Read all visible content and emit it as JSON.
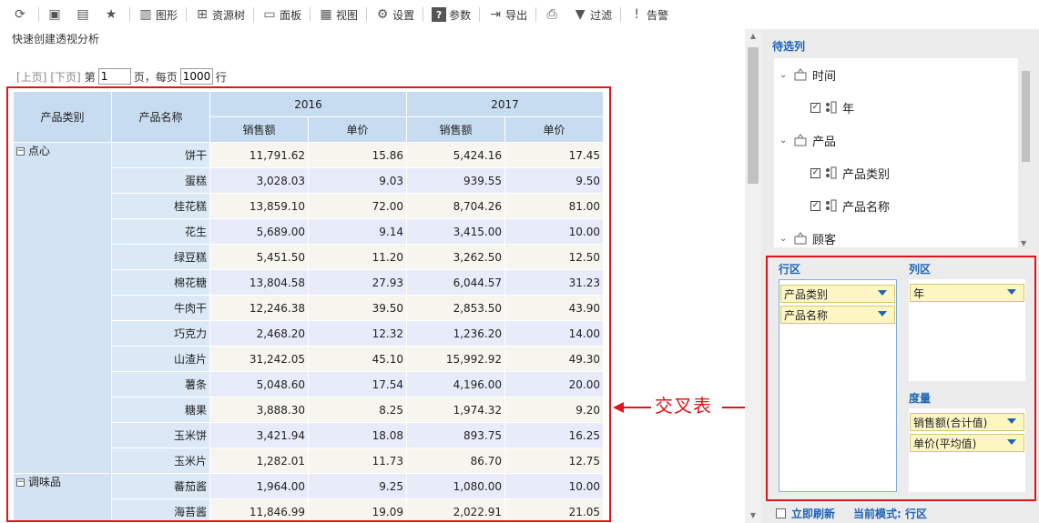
{
  "toolbar": {
    "items": [
      {
        "label": "",
        "icon": "refresh-icon"
      },
      {
        "label": "",
        "icon": "save-icon"
      },
      {
        "label": "",
        "icon": "save-as-icon"
      },
      {
        "label": "",
        "icon": "star-icon"
      },
      {
        "label": "图形",
        "icon": "chart-icon"
      },
      {
        "label": "资源树",
        "icon": "tree-icon"
      },
      {
        "label": "面板",
        "icon": "panel-icon"
      },
      {
        "label": "视图",
        "icon": "view-icon"
      },
      {
        "label": "设置",
        "icon": "gear-icon"
      },
      {
        "label": "参数",
        "icon": "question-icon"
      },
      {
        "label": "导出",
        "icon": "export-icon"
      },
      {
        "label": "",
        "icon": "print-icon"
      },
      {
        "label": "过滤",
        "icon": "filter-icon"
      },
      {
        "label": "告警",
        "icon": "alert-icon"
      }
    ]
  },
  "subtitle": "快速创建透视分析",
  "pager": {
    "prev": "[上页]",
    "next": "[下页]",
    "page_prefix": "第",
    "page_value": "1",
    "page_suffix": "页，每页",
    "rows_value": "1000",
    "rows_suffix": "行"
  },
  "table": {
    "row_headers": [
      "产品类别",
      "产品名称"
    ],
    "years": [
      "2016",
      "2017"
    ],
    "measures": [
      "销售额",
      "单价"
    ],
    "groups": [
      {
        "category": "点心",
        "rows": [
          {
            "name": "饼干",
            "v": [
              "11,791.62",
              "15.86",
              "5,424.16",
              "17.45"
            ]
          },
          {
            "name": "蛋糕",
            "v": [
              "3,028.03",
              "9.03",
              "939.55",
              "9.50"
            ]
          },
          {
            "name": "桂花糕",
            "v": [
              "13,859.10",
              "72.00",
              "8,704.26",
              "81.00"
            ]
          },
          {
            "name": "花生",
            "v": [
              "5,689.00",
              "9.14",
              "3,415.00",
              "10.00"
            ]
          },
          {
            "name": "绿豆糕",
            "v": [
              "5,451.50",
              "11.20",
              "3,262.50",
              "12.50"
            ]
          },
          {
            "name": "棉花糖",
            "v": [
              "13,804.58",
              "27.93",
              "6,044.57",
              "31.23"
            ]
          },
          {
            "name": "牛肉干",
            "v": [
              "12,246.38",
              "39.50",
              "2,853.50",
              "43.90"
            ]
          },
          {
            "name": "巧克力",
            "v": [
              "2,468.20",
              "12.32",
              "1,236.20",
              "14.00"
            ]
          },
          {
            "name": "山渣片",
            "v": [
              "31,242.05",
              "45.10",
              "15,992.92",
              "49.30"
            ]
          },
          {
            "name": "薯条",
            "v": [
              "5,048.60",
              "17.54",
              "4,196.00",
              "20.00"
            ]
          },
          {
            "name": "糖果",
            "v": [
              "3,888.30",
              "8.25",
              "1,974.32",
              "9.20"
            ]
          },
          {
            "name": "玉米饼",
            "v": [
              "3,421.94",
              "18.08",
              "893.75",
              "16.25"
            ]
          },
          {
            "name": "玉米片",
            "v": [
              "1,282.01",
              "11.73",
              "86.70",
              "12.75"
            ]
          }
        ]
      },
      {
        "category": "调味品",
        "rows": [
          {
            "name": "蕃茄酱",
            "v": [
              "1,964.00",
              "9.25",
              "1,080.00",
              "10.00"
            ]
          },
          {
            "name": "海苔酱",
            "v": [
              "11,846.99",
              "19.09",
              "2,022.91",
              "21.05"
            ]
          }
        ]
      }
    ]
  },
  "annotation": "交叉表",
  "panel": {
    "title": "待选列",
    "tree": [
      {
        "level": 0,
        "label": "时间",
        "type": "folder"
      },
      {
        "level": 1,
        "label": "年",
        "type": "field",
        "checked": true
      },
      {
        "level": 0,
        "label": "产品",
        "type": "folder"
      },
      {
        "level": 1,
        "label": "产品类别",
        "type": "field",
        "checked": true
      },
      {
        "level": 1,
        "label": "产品名称",
        "type": "field",
        "checked": true
      },
      {
        "level": 0,
        "label": "顾客",
        "type": "folder"
      }
    ],
    "row_zone_label": "行区",
    "col_zone_label": "列区",
    "measure_zone_label": "度量",
    "row_items": [
      "产品类别",
      "产品名称"
    ],
    "col_items": [
      "年"
    ],
    "measure_items": [
      "销售额(合计值)",
      "单价(平均值)"
    ],
    "refresh_label": "立即刷新",
    "mode_label": "当前模式: 行区"
  },
  "colors": {
    "accent": "#1e64b6",
    "annotation_red": "#e0141a",
    "header_bg": "#c7dcf0",
    "pill_bg": "#fdf6c3"
  }
}
